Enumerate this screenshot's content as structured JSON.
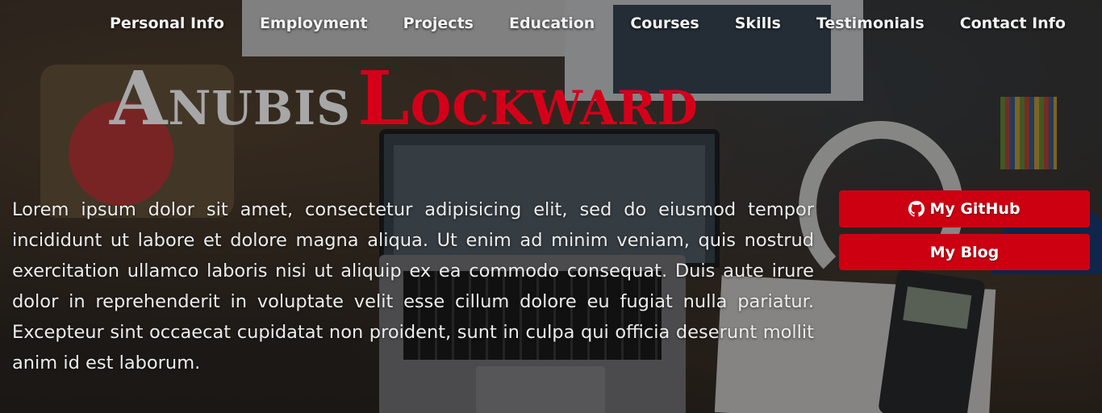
{
  "nav": {
    "items": [
      {
        "label": "Personal Info"
      },
      {
        "label": "Employment"
      },
      {
        "label": "Projects"
      },
      {
        "label": "Education"
      },
      {
        "label": "Courses"
      },
      {
        "label": "Skills"
      },
      {
        "label": "Testimonials"
      },
      {
        "label": "Contact Info"
      }
    ]
  },
  "hero": {
    "first_name_initial": "A",
    "first_name_rest": "NUBIS",
    "last_name_initial": "L",
    "last_name_rest": "OCKWARD",
    "bio": "Lorem ipsum dolor sit amet, consectetur adipisicing elit, sed do eiusmod tempor incididunt ut labore et dolore magna aliqua. Ut enim ad minim veniam, quis nostrud exercitation ullamco laboris nisi ut aliquip ex ea commodo consequat. Duis aute irure dolor in reprehenderit in voluptate velit esse cillum dolore eu fugiat nulla pariatur. Excepteur sint occaecat cupidatat non proident, sunt in culpa qui officia deserunt mollit anim id est laborum."
  },
  "buttons": {
    "github_label": "My GitHub",
    "github_icon": "github-icon",
    "blog_label": "My Blog"
  },
  "colors": {
    "accent": "#cc0011",
    "last_name": "#d4001a",
    "first_name": "#a7a7a7",
    "text": "#ececec"
  }
}
